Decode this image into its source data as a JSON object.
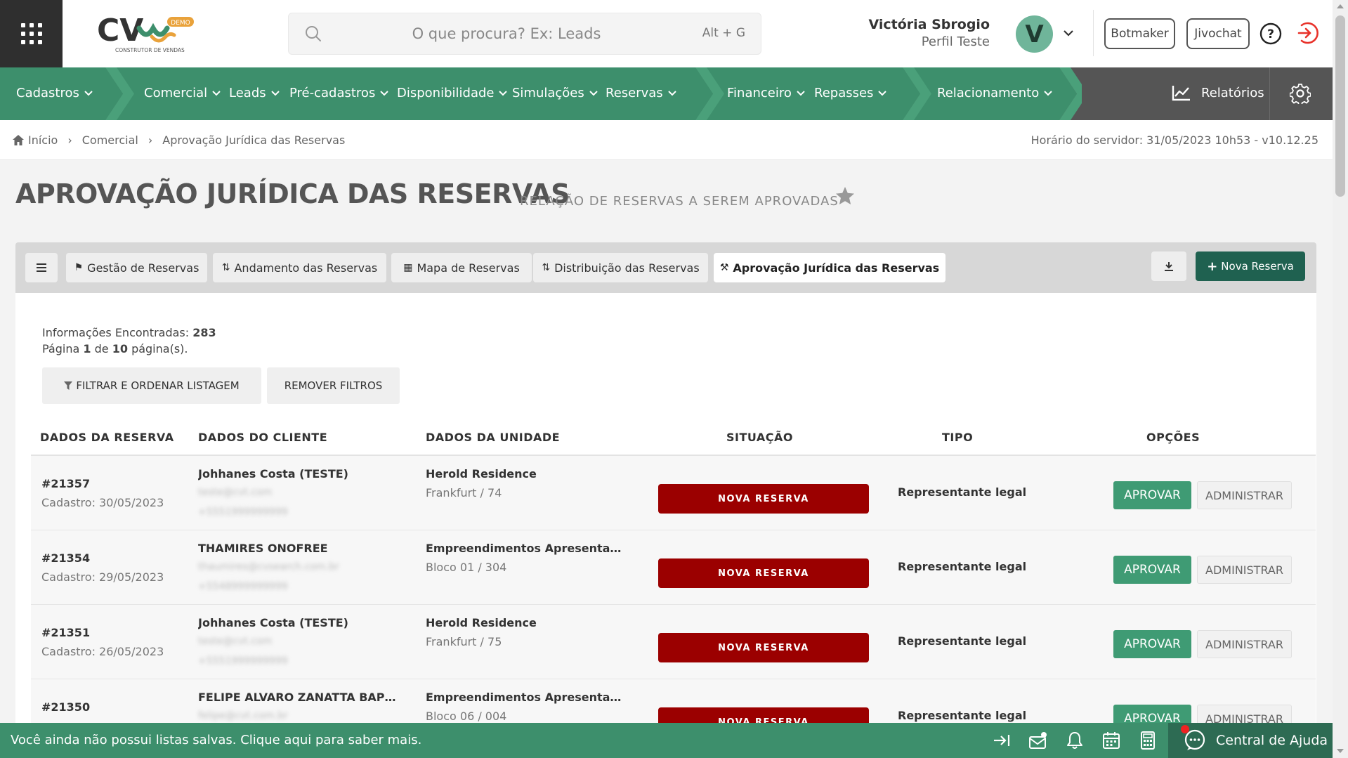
{
  "header": {
    "logo_text": "CV",
    "logo_tagline": "CONSTRUTOR DE VENDAS",
    "logo_badge": "DEMO",
    "search_placeholder": "O que procura? Ex: Leads",
    "search_shortcut": "Alt + G",
    "user_name": "Victória Sbrogio",
    "user_profile": "Perfil Teste",
    "avatar_letter": "V",
    "botmaker_label": "Botmaker",
    "jivochat_label": "Jivochat"
  },
  "nav": {
    "items": [
      {
        "label": "Cadastros"
      },
      {
        "label": "Comercial"
      },
      {
        "label": "Leads"
      },
      {
        "label": "Pré-cadastros"
      },
      {
        "label": "Disponibilidade"
      },
      {
        "label": "Simulações"
      },
      {
        "label": "Reservas"
      },
      {
        "label": "Financeiro"
      },
      {
        "label": "Repasses"
      },
      {
        "label": "Relacionamento"
      }
    ],
    "reports_label": "Relatórios"
  },
  "breadcrumb": {
    "home": "Início",
    "section": "Comercial",
    "current": "Aprovação Jurídica das Reservas"
  },
  "server_time": "Horário do servidor: 31/05/2023 10h53 - v10.12.25",
  "page": {
    "title": "APROVAÇÃO JURÍDICA DAS RESERVAS",
    "subtitle": "RELAÇÃO DE RESERVAS A SEREM APROVADAS"
  },
  "tabs": [
    {
      "label": "Gestão de Reservas",
      "icon": "bookmark-icon"
    },
    {
      "label": "Andamento das Reservas",
      "icon": "sort-icon"
    },
    {
      "label": "Mapa de Reservas",
      "icon": "map-icon"
    },
    {
      "label": "Distribuição das Reservas",
      "icon": "sort-icon"
    },
    {
      "label": "Aprovação Jurídica das Reservas",
      "icon": "gavel-icon",
      "active": true
    }
  ],
  "new_reservation_label": "Nova Reserva",
  "results": {
    "found_label": "Informações Encontradas:",
    "found_count": "283",
    "page_prefix": "Página",
    "page_current": "1",
    "page_of": "de",
    "page_total": "10",
    "page_suffix": "página(s)."
  },
  "filters": {
    "filter_label": "FILTRAR E  ORDENAR LISTAGEM",
    "remove_label": "REMOVER FILTROS"
  },
  "table": {
    "headers": [
      "DADOS DA RESERVA",
      "DADOS DO CLIENTE",
      "DADOS DA UNIDADE",
      "SITUAÇÃO",
      "TIPO",
      "OPÇÕES"
    ],
    "approve_label": "APROVAR",
    "admin_label": "ADMINISTRAR",
    "rows": [
      {
        "id": "#21357",
        "date": "Cadastro: 30/05/2023",
        "client": "Johhanes Costa (TESTE)",
        "email": "teste@cvt.com",
        "phone": "+5551999999999",
        "unit": "Herold Residence",
        "unit_sub": "Frankfurt / 74",
        "status": "NOVA RESERVA",
        "type": "Representante legal"
      },
      {
        "id": "#21354",
        "date": "Cadastro: 29/05/2023",
        "client": "THAMIRES ONOFREE",
        "email": "thaumires@cvsearch.com.br",
        "phone": "+5548999999999",
        "unit": "Empreendimentos Apresentação",
        "unit_sub": "Bloco 01 / 304",
        "status": "NOVA RESERVA",
        "type": "Representante legal"
      },
      {
        "id": "#21351",
        "date": "Cadastro: 26/05/2023",
        "client": "Johhanes Costa (TESTE)",
        "email": "teste@cvt.com",
        "phone": "+5551999999999",
        "unit": "Herold Residence",
        "unit_sub": "Frankfurt / 75",
        "status": "NOVA RESERVA",
        "type": "Representante legal"
      },
      {
        "id": "#21350",
        "date": "",
        "client": "FELIPE ALVARO ZANATTA BAPTISTA",
        "email": "felipe@cvt.com.br",
        "phone": "",
        "unit": "Empreendimentos Apresentação",
        "unit_sub": "Bloco 06 / 004",
        "status": "NOVA RESERVA",
        "type": "Representante legal"
      }
    ]
  },
  "bottom": {
    "message": "Você ainda não possui listas salvas. Clique aqui para saber mais.",
    "help_center_label": "Central de Ajuda"
  },
  "colors": {
    "brand_green": "#3d8f6c",
    "dark_green": "#1f6150",
    "status_red": "#9b0000",
    "approve_green": "#3f9b74"
  }
}
